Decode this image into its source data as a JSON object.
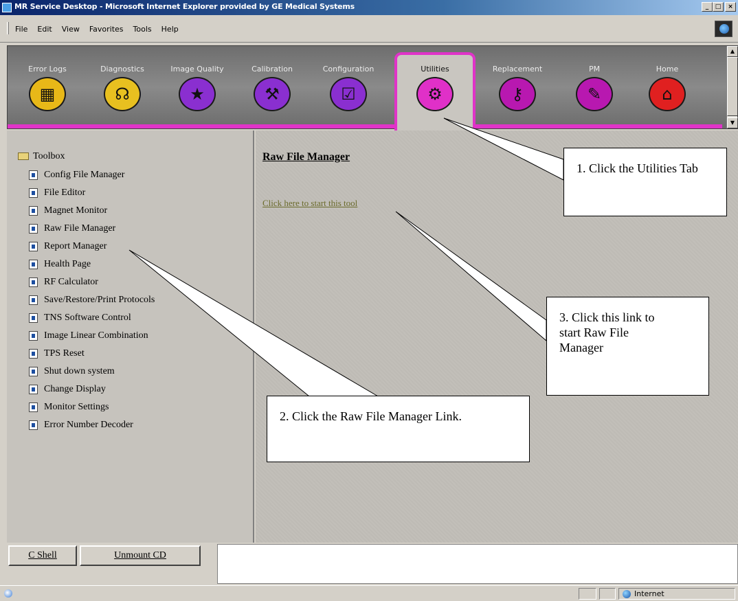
{
  "window": {
    "title": "MR Service Desktop - Microsoft Internet Explorer provided by GE Medical Systems",
    "min": "_",
    "max": "□",
    "close": "×"
  },
  "menu": [
    "File",
    "Edit",
    "View",
    "Favorites",
    "Tools",
    "Help"
  ],
  "tabs": [
    {
      "label": "Error Logs",
      "icon": "grid-icon",
      "glyph": "▦",
      "color": "#e8b818"
    },
    {
      "label": "Diagnostics",
      "icon": "stethoscope-icon",
      "glyph": "☊",
      "color": "#e8c020"
    },
    {
      "label": "Image Quality",
      "icon": "monitor-star-icon",
      "glyph": "★",
      "color": "#8a2fd0"
    },
    {
      "label": "Calibration",
      "icon": "caliper-icon",
      "glyph": "⚒",
      "color": "#8a2fd0"
    },
    {
      "label": "Configuration",
      "icon": "checklist-icon",
      "glyph": "☑",
      "color": "#8a2fd0"
    },
    {
      "label": "Utilities",
      "icon": "toolbox-icon",
      "glyph": "⚙",
      "color": "#e030c8",
      "active": true
    },
    {
      "label": "Replacement",
      "icon": "wrench-icon",
      "glyph": "⚷",
      "color": "#b818b0"
    },
    {
      "label": "PM",
      "icon": "clipboard-icon",
      "glyph": "✎",
      "color": "#b818b0"
    },
    {
      "label": "Home",
      "icon": "home-icon",
      "glyph": "⌂",
      "color": "#e02020"
    }
  ],
  "sidebar": {
    "root": "Toolbox",
    "items": [
      "Config File Manager",
      "File Editor",
      "Magnet Monitor",
      "Raw File Manager",
      "Report Manager",
      "Health Page",
      "RF Calculator",
      "Save/Restore/Print Protocols",
      "TNS Software Control",
      "Image Linear Combination",
      "TPS Reset",
      "Shut down system",
      "Change Display",
      "Monitor Settings",
      "Error Number Decoder"
    ]
  },
  "main": {
    "title": "Raw File Manager",
    "link": "Click here to start this tool"
  },
  "bottom": {
    "cshell": "C Shell",
    "unmount": "Unmount CD"
  },
  "status": {
    "zone": "Internet"
  },
  "callouts": {
    "c1": "1. Click the Utilities Tab",
    "c2": "2. Click the Raw File Manager Link.",
    "c3": "3. Click this link to start Raw File Manager"
  }
}
